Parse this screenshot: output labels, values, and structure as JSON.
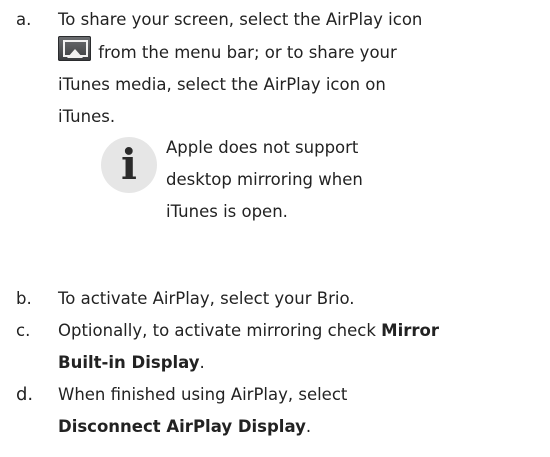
{
  "steps": [
    {
      "marker": "a.",
      "lines": [
        "To share your screen, select the AirPlay icon",
        " from the menu bar; or to share your",
        "iTunes media, select the AirPlay icon on",
        "iTunes."
      ],
      "icon": "airplay-icon"
    },
    {
      "marker": "b.",
      "lines": [
        "To activate AirPlay, select your Brio."
      ]
    },
    {
      "marker": "c.",
      "lines": [
        "Optionally, to activate mirroring check ",
        "Mirror",
        "Built-in Display",
        "."
      ]
    },
    {
      "marker": "d.",
      "lines": [
        "When finished using AirPlay, select",
        "Disconnect AirPlay Display",
        "."
      ]
    }
  ],
  "note": {
    "icon": "info-icon",
    "glyph": "i",
    "lines": [
      "Apple does not support",
      "desktop mirroring when",
      "iTunes is open."
    ]
  }
}
